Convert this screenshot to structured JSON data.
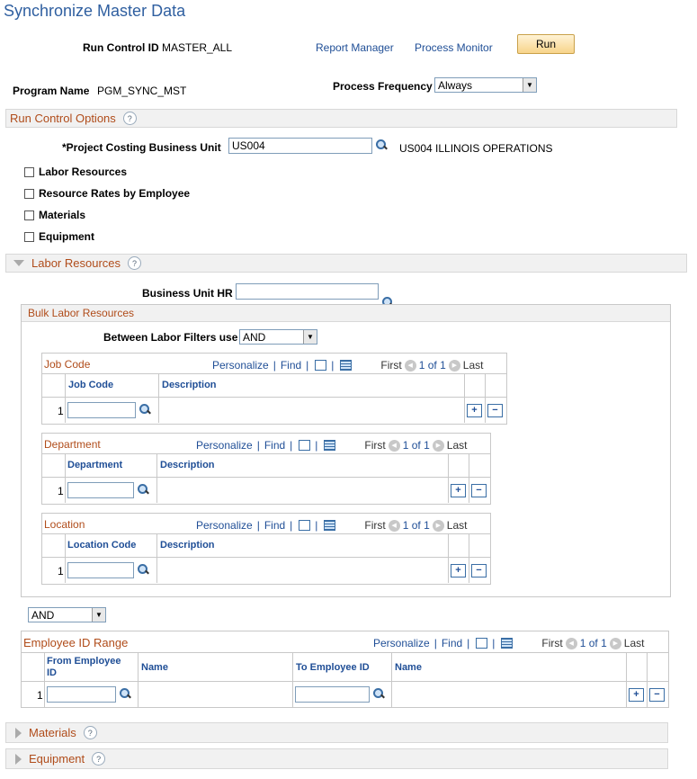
{
  "page": {
    "title": "Synchronize Master Data"
  },
  "header": {
    "run_control_label": "Run Control ID",
    "run_control_value": "MASTER_ALL",
    "report_manager": "Report Manager",
    "process_monitor": "Process Monitor",
    "run_button": "Run",
    "program_name_label": "Program Name",
    "program_name_value": "PGM_SYNC_MST",
    "frequency_label": "Process Frequency",
    "frequency_value": "Always"
  },
  "run_control_options": {
    "title": "Run Control Options",
    "bu_label": "*Project Costing Business Unit",
    "bu_value": "US004",
    "bu_desc": "US004 ILLINOIS OPERATIONS",
    "checkboxes": [
      "Labor Resources",
      "Resource Rates by Employee",
      "Materials",
      "Equipment"
    ]
  },
  "labor_resources": {
    "title": "Labor Resources",
    "bu_hr_label": "Business Unit HR",
    "bu_hr_value": "",
    "bulk_title": "Bulk Labor Resources",
    "between_label": "Between Labor Filters use",
    "between_value": "AND"
  },
  "nav": {
    "personalize": "Personalize",
    "find": "Find",
    "first": "First",
    "of": "1 of 1",
    "last": "Last",
    "sep": "|"
  },
  "grids": {
    "job_code": {
      "title": "Job Code",
      "col1": "Job Code",
      "col2": "Description",
      "row": "1"
    },
    "department": {
      "title": "Department",
      "col1": "Department",
      "col2": "Description",
      "row": "1"
    },
    "location": {
      "title": "Location",
      "col1": "Location Code",
      "col2": "Description",
      "row": "1"
    },
    "employee": {
      "title": "Employee ID Range",
      "col1a": "From Employee",
      "col1b": "ID",
      "col2": "Name",
      "col3": "To Employee ID",
      "col4": "Name",
      "row": "1"
    }
  },
  "and_select": "AND",
  "collapsed": {
    "materials": "Materials",
    "equipment": "Equipment"
  },
  "icons": {
    "help": "?",
    "plus": "+",
    "minus": "−",
    "prev": "◀",
    "next": "▶",
    "dropdown": "▼"
  }
}
